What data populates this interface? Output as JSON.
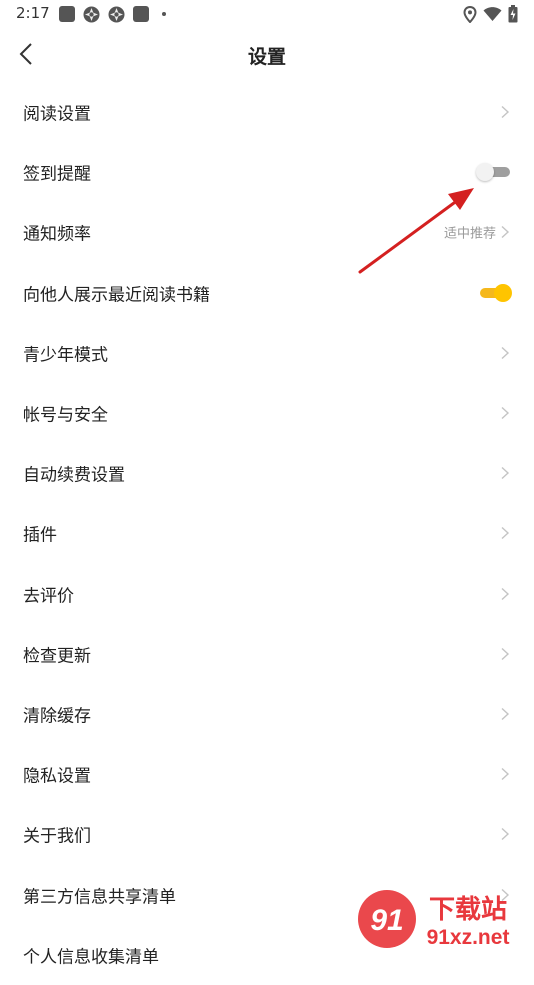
{
  "status_bar": {
    "time": "2:17",
    "icons": [
      "notification-square-icon",
      "aperture-icon",
      "aperture-icon",
      "notification-square-icon",
      "more-dot-icon",
      "location-icon",
      "wifi-icon",
      "battery-icon"
    ]
  },
  "header": {
    "title": "设置",
    "back_icon": "chevron-left-icon"
  },
  "settings": {
    "reading_settings": "阅读设置",
    "checkin_reminder": "签到提醒",
    "checkin_reminder_enabled": false,
    "notification_frequency": "通知频率",
    "notification_frequency_value": "适中推荐",
    "show_recent_reading": "向他人展示最近阅读书籍",
    "show_recent_reading_enabled": true,
    "teen_mode": "青少年模式",
    "account_security": "帐号与安全",
    "auto_renew": "自动续费设置",
    "plugins": "插件",
    "rate_app": "去评价",
    "check_update": "检查更新",
    "clear_cache": "清除缓存",
    "privacy_settings": "隐私设置",
    "about_us": "关于我们",
    "third_party_sharing": "第三方信息共享清单",
    "personal_info_collection": "个人信息收集清单"
  },
  "colors": {
    "toggle_on": "#ffc400",
    "toggle_off_track": "#9f9f9f",
    "annotation_arrow": "#d42020",
    "watermark_red": "#e8383d"
  },
  "watermark": {
    "logo_text": "91",
    "main": "下载站",
    "site": "91xz.net"
  }
}
